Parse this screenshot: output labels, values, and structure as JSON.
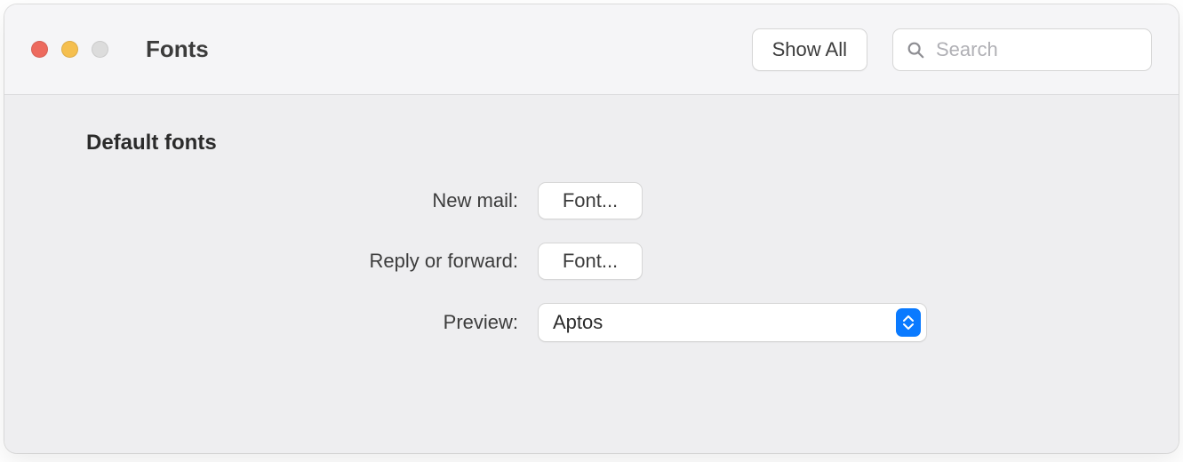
{
  "window": {
    "title": "Fonts"
  },
  "toolbar": {
    "show_all_label": "Show All",
    "search_placeholder": "Search"
  },
  "section": {
    "title": "Default fonts",
    "rows": {
      "new_mail": {
        "label": "New mail:",
        "button_label": "Font..."
      },
      "reply_forward": {
        "label": "Reply or forward:",
        "button_label": "Font..."
      },
      "preview": {
        "label": "Preview:",
        "selected_value": "Aptos"
      }
    }
  }
}
